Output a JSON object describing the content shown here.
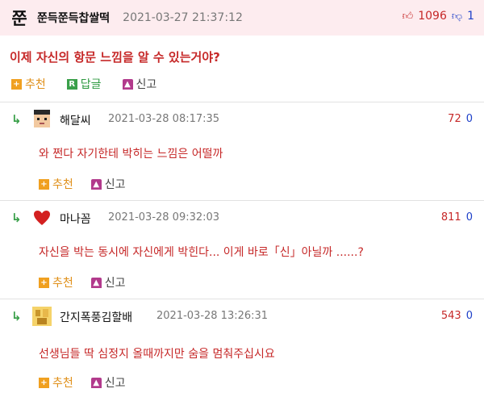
{
  "post": {
    "logo": "쭌",
    "author": "쭌득쭌득찹쌀떡",
    "time": "2021-03-27 21:37:12",
    "upvotes": "1096",
    "downvotes": "1",
    "body": "이제 자신의 항문 느낌을 알 수 있는거야?",
    "actions": {
      "recommend": "추천",
      "reply": "답글",
      "report": "신고"
    }
  },
  "comments": [
    {
      "author": "해달씨",
      "time": "2021-03-28 08:17:35",
      "up": "72",
      "down": "0",
      "text": "와 쩐다 자기한테 박히는 느낌은 어떨까",
      "recommend": "추천",
      "report": "신고",
      "avatar_icon": "pixel-face-icon"
    },
    {
      "author": "마나꼼",
      "time": "2021-03-28 09:32:03",
      "up": "811",
      "down": "0",
      "text": "자신을 박는 동시에 자신에게 박힌다... 이게 바로「신」아닐까 ......?",
      "recommend": "추천",
      "report": "신고",
      "avatar_icon": "heart-icon"
    },
    {
      "author": "간지폭풍김할배",
      "time": "2021-03-28 13:26:31",
      "up": "543",
      "down": "0",
      "text": "선생님들 딱 심정지 올때까지만 숨을 멈춰주십시요",
      "recommend": "추천",
      "report": "신고",
      "avatar_icon": "gold-avatar-icon"
    }
  ],
  "colors": {
    "header_bg": "#fdecef",
    "accent_red": "#c62828",
    "accent_blue": "#1e40c9",
    "reply_green": "#3aa04a"
  }
}
